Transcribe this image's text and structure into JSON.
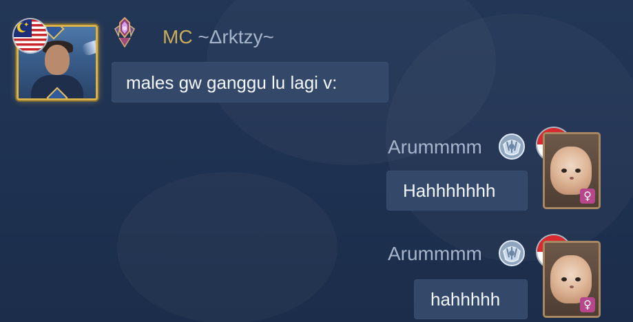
{
  "messages": [
    {
      "side": "left",
      "prefix": "MC",
      "name": "~Δrktzy~",
      "text": "males gw ganggu lu lagi v:"
    },
    {
      "side": "right",
      "name": "Arummmm",
      "text": "Hahhhhhhh"
    },
    {
      "side": "right",
      "name": "Arummmm",
      "text": "hahhhhh"
    }
  ],
  "icons": {
    "left_flag": "malaysia-flag-icon",
    "right_flag": "indonesia-flag-icon",
    "left_rank": "rank-emblem-icon",
    "right_rank": "rank-emblem-icon",
    "gender": "female-icon"
  },
  "colors": {
    "background": "#213453",
    "bubble": "#34496a",
    "mc_prefix": "#c9ae5a",
    "name": "#a6b5cc",
    "text": "#f2f6fb",
    "gender_badge": "#b8468a"
  },
  "badges": {
    "gender_symbol": "♀"
  }
}
